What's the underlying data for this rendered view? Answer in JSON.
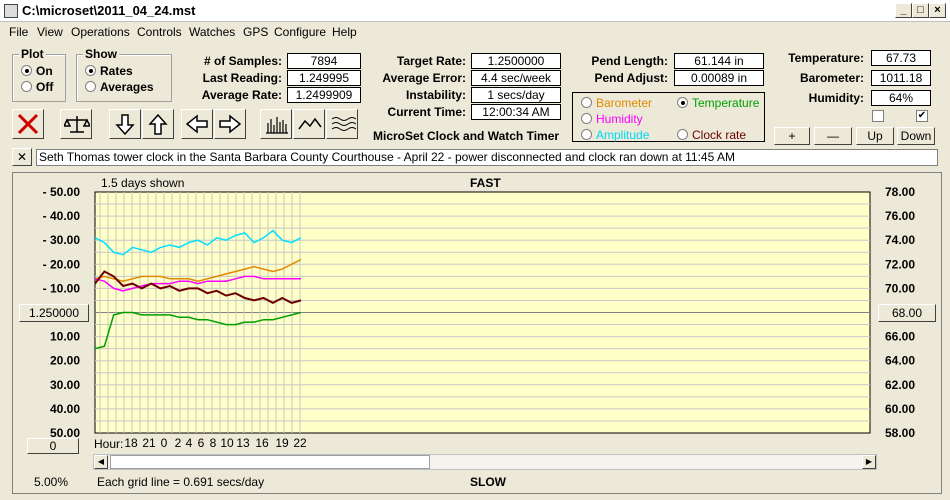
{
  "window": {
    "title": "C:\\microset\\2011_04_24.mst"
  },
  "menu": [
    "File",
    "View",
    "Operations",
    "Controls",
    "Watches",
    "GPS",
    "Configure",
    "Help"
  ],
  "plot_group": {
    "title": "Plot",
    "on": "On",
    "off": "Off"
  },
  "show_group": {
    "title": "Show",
    "rates": "Rates",
    "averages": "Averages"
  },
  "stats": {
    "samples_label": "# of Samples:",
    "samples": "7894",
    "last_label": "Last Reading:",
    "last": "1.249995",
    "avg_label": "Average Rate:",
    "avg": "1.2499909"
  },
  "rates": {
    "target_label": "Target Rate:",
    "target": "1.2500000",
    "avgerr_label": "Average Error:",
    "avgerr": "4.4 sec/week",
    "instab_label": "Instability:",
    "instab": "1 secs/day",
    "time_label": "Current Time:",
    "time": "12:00:34 AM"
  },
  "pend": {
    "length_label": "Pend Length:",
    "length": "61.144 in",
    "adjust_label": "Pend Adjust:",
    "adjust": "0.00089 in"
  },
  "env": {
    "temp_label": "Temperature:",
    "temp": "67.73",
    "baro_label": "Barometer:",
    "baro": "1011.18",
    "hum_label": "Humidity:",
    "hum": "64%",
    "check2": "✔"
  },
  "sensor_options": {
    "barometer": "Barometer",
    "temperature": "Temperature",
    "humidity": "Humidity",
    "amplitude": "Amplitude",
    "clockrate": "Clock rate"
  },
  "adjust_buttons": {
    "plus": "+",
    "minus": "—",
    "up": "Up",
    "down": "Down"
  },
  "app_name": "MicroSet Clock and Watch Timer",
  "close_x": "✕",
  "note": "Seth Thomas tower clock in the Santa Barbara County Courthouse - April 22 - power disconnected and clock ran down at 11:45 AM",
  "chart_labels": {
    "days_shown": "1.5 days shown",
    "top": "FAST",
    "bottom": "SLOW",
    "left_center_button": "1.250000",
    "right_center_button": "68.00",
    "zero_button": "0",
    "hour_label": "Hour:",
    "grid_note": "Each grid line = 0.691 secs/day",
    "zoom": "5.00%"
  },
  "colors": {
    "plot_bg": "#ffffc8",
    "barometer": "#e08a00",
    "temperature": "#00a000",
    "humidity": "#ff00ff",
    "amplitude": "#00e0ff",
    "clockrate": "#6e0000"
  },
  "chart_data": {
    "type": "line",
    "left_axis": {
      "ticks": [
        "- 50.00",
        "- 40.00",
        "- 30.00",
        "- 20.00",
        "- 10.00",
        "10.00",
        "20.00",
        "30.00",
        "40.00",
        "50.00"
      ]
    },
    "right_axis": {
      "ticks": [
        "78.00",
        "76.00",
        "74.00",
        "72.00",
        "70.00",
        "68.00",
        "66.00",
        "64.00",
        "62.00",
        "60.00",
        "58.00"
      ],
      "range": [
        58,
        78
      ]
    },
    "x_ticks": [
      "18",
      "21",
      "0",
      "2",
      "4",
      "6",
      "8",
      "10",
      "13",
      "16",
      "19",
      "22"
    ],
    "series": [
      {
        "key": "amplitude",
        "values": [
          31,
          29,
          25,
          24,
          27,
          26,
          25,
          27,
          28,
          27,
          29,
          30,
          28,
          31,
          30,
          32,
          33,
          29,
          31,
          34,
          30,
          29,
          31
        ]
      },
      {
        "key": "barometer",
        "values": [
          14,
          15,
          14,
          13,
          14,
          15,
          15,
          15,
          14,
          14,
          14,
          13,
          14,
          15,
          16,
          17,
          18,
          19,
          18,
          17,
          18,
          20,
          22
        ]
      },
      {
        "key": "humidity",
        "values": [
          14,
          13,
          10,
          9,
          10,
          11,
          12,
          12,
          12,
          13,
          13,
          12,
          13,
          13,
          13,
          14,
          15,
          15,
          14,
          14,
          14,
          14,
          14
        ]
      },
      {
        "key": "clockrate",
        "values": [
          12,
          17,
          15,
          11,
          12,
          10,
          12,
          10,
          11,
          9,
          10,
          10,
          8,
          9,
          7,
          8,
          6,
          5,
          6,
          4,
          6,
          4,
          5
        ]
      },
      {
        "key": "temperature",
        "values": [
          -15,
          -14,
          -1,
          0,
          0,
          -1,
          -1,
          -1,
          -1,
          -2,
          -2,
          -3,
          -3,
          -4,
          -5,
          -5,
          -4,
          -4,
          -3,
          -3,
          -2,
          -1,
          0
        ]
      }
    ]
  }
}
